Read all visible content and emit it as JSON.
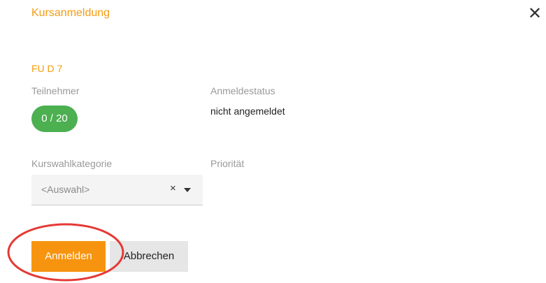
{
  "dialog": {
    "title": "Kursanmeldung",
    "close_icon": "close-icon"
  },
  "course": {
    "code": "FU D 7"
  },
  "participants": {
    "label": "Teilnehmer",
    "count": "0 / 20",
    "badge_color": "#4caf50"
  },
  "registration_status": {
    "label": "Anmeldestatus",
    "value": "nicht angemeldet"
  },
  "category": {
    "label": "Kurswahlkategorie",
    "placeholder": "<Auswahl>",
    "clear_glyph": "×"
  },
  "priority": {
    "label": "Priorität"
  },
  "buttons": {
    "submit_label": "Anmelden",
    "cancel_label": "Abbrechen"
  },
  "colors": {
    "accent": "#f39c12",
    "primary_button": "#f7940f",
    "annotation_ring": "#e53935"
  }
}
